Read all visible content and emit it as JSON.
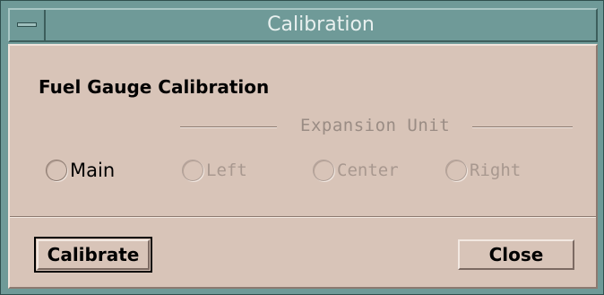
{
  "window": {
    "title": "Calibration",
    "menu_icon": "window-menu-icon"
  },
  "content": {
    "heading": "Fuel Gauge Calibration",
    "expansion_label": "Expansion Unit",
    "radios": [
      {
        "label": "Main",
        "enabled": true,
        "selected": false
      },
      {
        "label": "Left",
        "enabled": false,
        "selected": false
      },
      {
        "label": "Center",
        "enabled": false,
        "selected": false
      },
      {
        "label": "Right",
        "enabled": false,
        "selected": false
      }
    ]
  },
  "buttons": {
    "calibrate_label": "Calibrate",
    "close_label": "Close"
  },
  "colors": {
    "titlebar": "#6f9a98",
    "client_bg": "#d8c4b8",
    "disabled_text": "#a8988f"
  }
}
